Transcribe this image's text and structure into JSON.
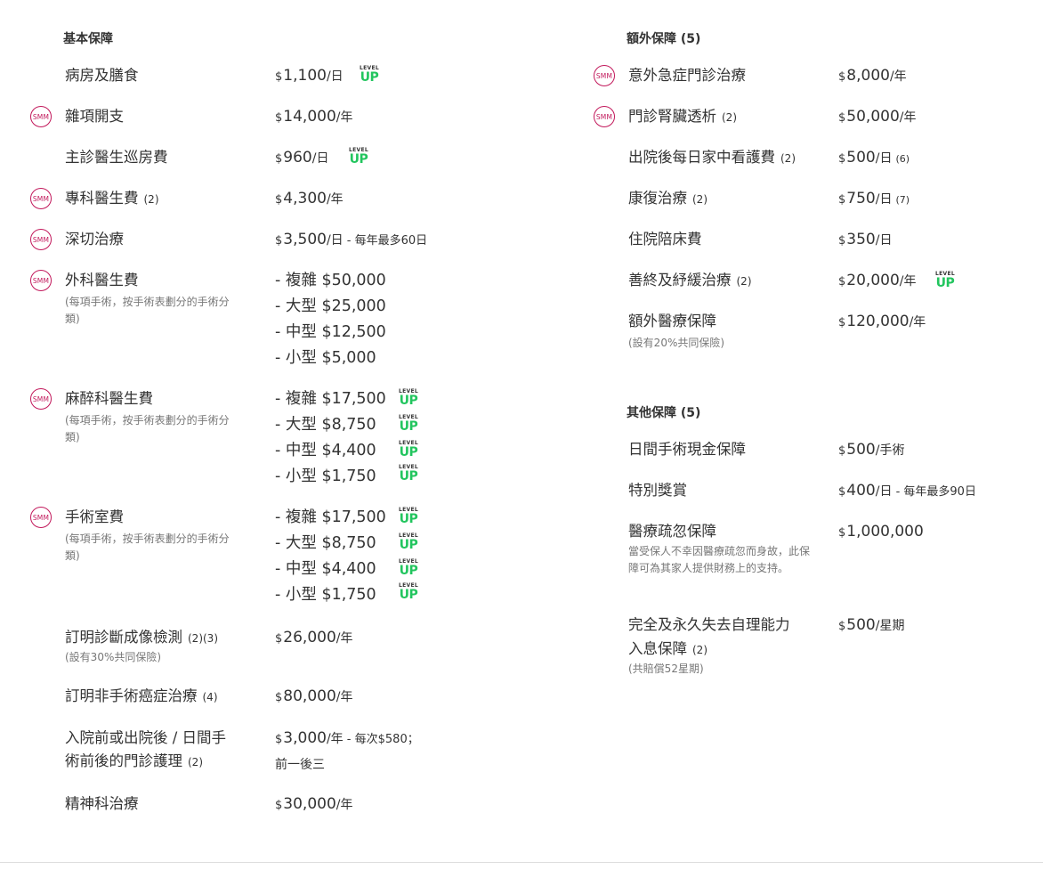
{
  "left": {
    "title": "基本保障",
    "rows": [
      {
        "label": "病房及膳食",
        "cur": "$",
        "amount": "1,100",
        "unit": "/日",
        "levelup": true
      },
      {
        "label": "雜項開支",
        "smm": true,
        "cur": "$",
        "amount": "14,000",
        "unit": "/年"
      },
      {
        "label": "主診醫生巡房費",
        "cur": "$",
        "amount": "960",
        "unit": "/日",
        "levelup": true
      },
      {
        "label": "專科醫生費",
        "ref": "(2)",
        "smm": true,
        "cur": "$",
        "amount": "4,300",
        "unit": "/年"
      },
      {
        "label": "深切治療",
        "smm": true,
        "cur": "$",
        "amount": "3,500",
        "unit": "/日",
        "note": " - 每年最多60日"
      }
    ],
    "surgeon": {
      "label": "外科醫生費",
      "sub": "(每項手術，按手術表劃分的手術分類)",
      "tiers": [
        "- 複雜 $50,000",
        "- 大型 $25,000",
        "- 中型 $12,500",
        "- 小型 $5,000"
      ]
    },
    "anaesthetist": {
      "label": "麻醉科醫生費",
      "sub": "(每項手術，按手術表劃分的手術分類)",
      "tiers": [
        "- 複雜 $17,500",
        "- 大型 $8,750",
        "- 中型 $4,400",
        "- 小型 $1,750"
      ]
    },
    "theatre": {
      "label": "手術室費",
      "sub": "(每項手術，按手術表劃分的手術分類)",
      "tiers": [
        "- 複雜 $17,500",
        "- 大型 $8,750",
        "- 中型 $4,400",
        "- 小型 $1,750"
      ]
    },
    "imaging": {
      "label": "訂明診斷成像檢測",
      "ref": "(2)(3)",
      "sub": "(設有30%共同保險)",
      "cur": "$",
      "amount": "26,000",
      "unit": "/年"
    },
    "cancer": {
      "label": "訂明非手術癌症治療",
      "ref": "(4)",
      "cur": "$",
      "amount": "80,000",
      "unit": "/年"
    },
    "outpatient": {
      "label1": "入院前或出院後 / 日間手",
      "label2": "術前後的門診護理",
      "ref": "(2)",
      "cur": "$",
      "amount": "3,000",
      "unit": "/年",
      "note": " - 每次$580；",
      "note2": "前一後三"
    },
    "psych": {
      "label": "精神科治療",
      "cur": "$",
      "amount": "30,000",
      "unit": "/年"
    }
  },
  "right": {
    "extra_title": "額外保障 (5)",
    "extra_rows": [
      {
        "label": "意外急症門診治療",
        "smm": true,
        "cur": "$",
        "amount": "8,000",
        "unit": "/年"
      },
      {
        "label": "門診腎臟透析",
        "ref": "(2)",
        "smm": true,
        "cur": "$",
        "amount": "50,000",
        "unit": "/年"
      },
      {
        "label": "出院後每日家中看護費",
        "ref": "(2)",
        "cur": "$",
        "amount": "500",
        "unit": "/日",
        "vref": "(6)"
      },
      {
        "label": "康復治療",
        "ref": "(2)",
        "cur": "$",
        "amount": "750",
        "unit": "/日",
        "vref": "(7)"
      },
      {
        "label": "住院陪床費",
        "cur": "$",
        "amount": "350",
        "unit": "/日"
      },
      {
        "label": "善終及紓緩治療",
        "ref": "(2)",
        "cur": "$",
        "amount": "20,000",
        "unit": "/年",
        "levelup": true
      }
    ],
    "extra_medical": {
      "label": "額外醫療保障",
      "sub": "(設有20%共同保險)",
      "cur": "$",
      "amount": "120,000",
      "unit": "/年"
    },
    "other_title": "其他保障 (5)",
    "other_rows": [
      {
        "label": "日間手術現金保障",
        "cur": "$",
        "amount": "500",
        "unit": "/手術"
      },
      {
        "label": "特別獎賞",
        "cur": "$",
        "amount": "400",
        "unit": "/日",
        "note": " - 每年最多90日"
      }
    ],
    "negligence": {
      "label": "醫療疏忽保障",
      "sub": "當受保人不幸因醫療疏忽而身故，此保障可為其家人提供財務上的支持。",
      "cur": "$",
      "amount": "1,000,000"
    },
    "disability": {
      "label1": "完全及永久失去自理能力",
      "label2": "入息保障",
      "ref": "(2)",
      "sub": "(共賠償52星期)",
      "cur": "$",
      "amount": "500",
      "unit": "/星期"
    }
  },
  "levelup": {
    "top": "LEVEL",
    "bottom": "UP"
  },
  "smm_text": "SMM",
  "colors": {
    "smm": "#c2185b",
    "levelup": "#22c55e",
    "text": "#333333",
    "muted": "#777777"
  }
}
